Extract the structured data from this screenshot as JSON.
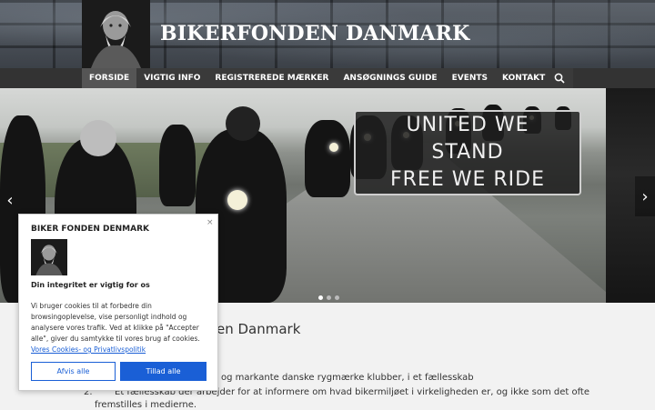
{
  "header": {
    "site_title": "BIKERFONDEN DANMARK",
    "logo_icon": "viking-portrait-icon"
  },
  "nav": {
    "items": [
      {
        "label": "FORSIDE",
        "active": true
      },
      {
        "label": "VIGTIG INFO",
        "active": false
      },
      {
        "label": "REGISTREREDE MÆRKER",
        "active": false
      },
      {
        "label": "ANSØGNINGS GUIDE",
        "active": false
      },
      {
        "label": "EVENTS",
        "active": false
      },
      {
        "label": "KONTAKT",
        "active": false
      }
    ],
    "search_icon": "search-icon"
  },
  "slider": {
    "slogan_line1": "UNITED WE",
    "slogan_line2": "STAND",
    "slogan_line3": "FREE WE RIDE",
    "prev_icon": "chevron-left-icon",
    "next_icon": "chevron-right-icon",
    "prev_glyph": "‹",
    "next_glyph": "›",
    "slide_count": 3,
    "active_slide": 1
  },
  "content": {
    "title_visible": "en Danmark",
    "line1": "og markante danske rygmærke klubber, i et fællesskab",
    "line2_num": "2.",
    "line2": "Et fællesskab der arbejder for at informere om hvad bikermiljøet i virkeligheden er, og ikke som det ofte",
    "line3": "fremstilles i medierne."
  },
  "cookie": {
    "title": "BIKER FONDEN DENMARK",
    "close": "×",
    "subtitle": "Din integritet er vigtig for os",
    "text": "Vi bruger cookies til at forbedre din browsingoplevelse, vise personligt indhold og analysere vores trafik. Ved at klikke på \"Accepter alle\", giver du samtykke til vores brug af cookies.",
    "link": "Vores Cookies- og Privatlivspolitik",
    "reject_label": "Afvis alle",
    "accept_label": "Tillad alle"
  },
  "colors": {
    "accent": "#1a5fd6",
    "nav_bg": "#333333",
    "nav_active": "#555555"
  }
}
